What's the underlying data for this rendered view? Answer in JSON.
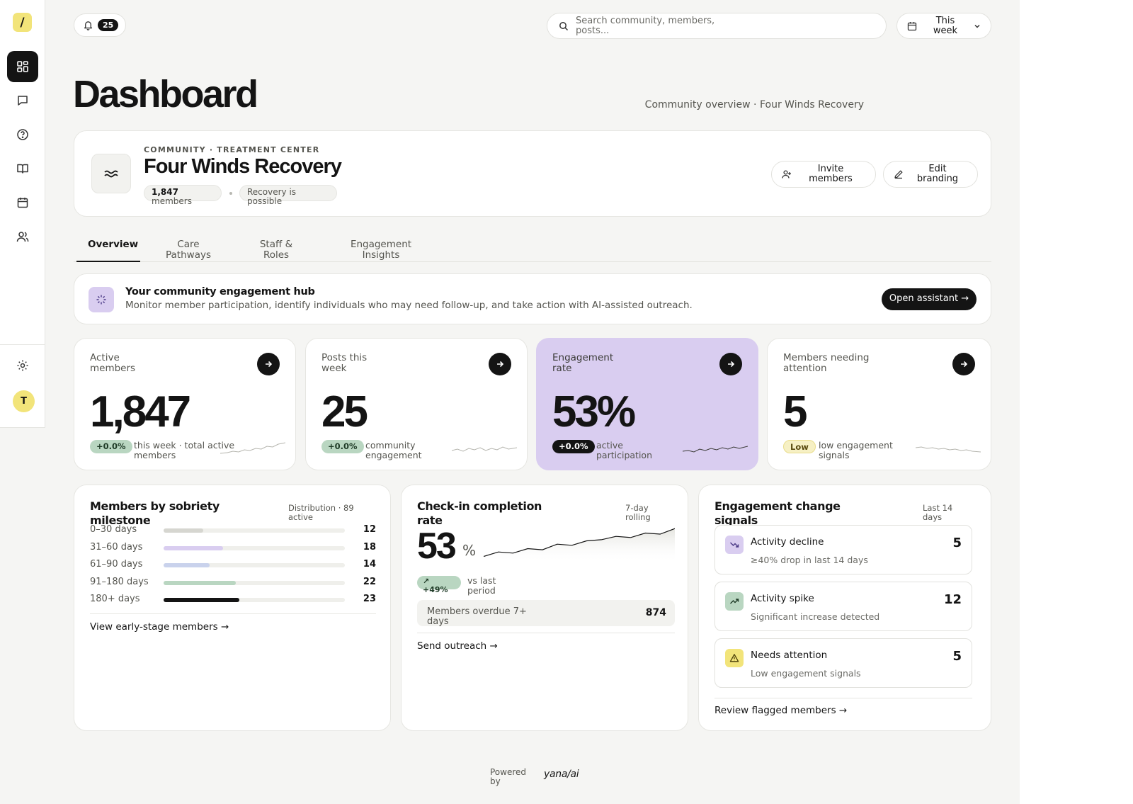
{
  "sidebar": {
    "logo": "/",
    "items": [
      {
        "icon": "dashboard-icon",
        "active": true
      },
      {
        "icon": "chat-icon"
      },
      {
        "icon": "help-icon"
      },
      {
        "icon": "book-icon"
      },
      {
        "icon": "calendar-icon"
      },
      {
        "icon": "users-icon"
      }
    ],
    "settings_icon": "gear-icon",
    "avatar_initial": "T"
  },
  "topbar": {
    "notification_count": "25",
    "search_placeholder": "Search community, members, posts...",
    "period_label": "This week"
  },
  "header": {
    "title": "Dashboard",
    "subtitle": "Community overview · Four Winds Recovery"
  },
  "community": {
    "kicker": "COMMUNITY · TREATMENT CENTER",
    "name": "Four Winds Recovery",
    "member_count": "1,847",
    "member_suffix": "members",
    "tagline": "Recovery is possible",
    "invite_label": "Invite members",
    "edit_label": "Edit branding"
  },
  "tabs": [
    "Overview",
    "Care Pathways",
    "Staff & Roles",
    "Engagement Insights"
  ],
  "hub": {
    "title": "Your community engagement hub",
    "description": "Monitor member participation, identify individuals who may need follow-up, and take action with AI-assisted outreach.",
    "button": "Open assistant →"
  },
  "stats": [
    {
      "label": "Active members",
      "value": "1,847",
      "badge": "+0.0%",
      "note": "this week · total active members"
    },
    {
      "label": "Posts this week",
      "value": "25",
      "badge": "+0.0%",
      "note": "community engagement"
    },
    {
      "label": "Engagement rate",
      "value": "53%",
      "badge": "+0.0%",
      "note": "active participation"
    },
    {
      "label": "Members needing attention",
      "value": "5",
      "badge": "Low",
      "note": "low engagement signals"
    }
  ],
  "milestones": {
    "title": "Members by sobriety milestone",
    "meta": "Distribution · 89 active",
    "rows": [
      {
        "label": "0–30 days",
        "count": "12",
        "value": 12,
        "color": "#d6d6d0"
      },
      {
        "label": "31–60 days",
        "count": "18",
        "value": 18,
        "color": "#d9cdf0"
      },
      {
        "label": "61–90 days",
        "count": "14",
        "value": 14,
        "color": "#c9d2ec"
      },
      {
        "label": "91–180 days",
        "count": "22",
        "value": 22,
        "color": "#b9d6c1"
      },
      {
        "label": "180+ days",
        "count": "23",
        "value": 23,
        "color": "#141414"
      }
    ],
    "max": 55,
    "link": "View early-stage members →"
  },
  "checkin": {
    "title": "Check-in completion rate",
    "meta": "7-day rolling",
    "value": "53",
    "unit": "%",
    "badge": "↗ +49%",
    "vs": "vs last period",
    "overdue_label": "Members overdue 7+ days",
    "overdue_value": "874",
    "link": "Send outreach →",
    "trend": [
      22,
      26,
      25,
      29,
      28,
      33,
      32,
      36,
      37,
      40,
      39,
      43,
      42,
      47
    ]
  },
  "signals": {
    "title": "Engagement change signals",
    "meta": "Last 14 days",
    "items": [
      {
        "icon": "trend-down-icon",
        "title": "Activity decline",
        "desc": "≥40% drop in last 14 days",
        "count": "5",
        "color": "#d9cdf0"
      },
      {
        "icon": "trend-up-icon",
        "title": "Activity spike",
        "desc": "Significant increase detected",
        "count": "12",
        "color": "#b9d6c1"
      },
      {
        "icon": "warning-icon",
        "title": "Needs attention",
        "desc": "Low engagement signals",
        "count": "5",
        "color": "#f2e47a"
      }
    ],
    "link": "Review flagged members →"
  },
  "footer": {
    "powered": "Powered by",
    "brand": "yana/ai"
  }
}
